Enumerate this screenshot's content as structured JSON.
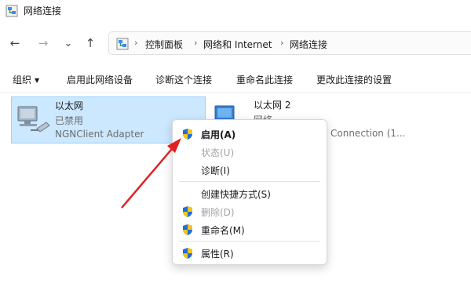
{
  "window": {
    "title": "网络连接"
  },
  "nav": {
    "back": "←",
    "forward": "→",
    "recent": "⌄",
    "up": "↑"
  },
  "address": {
    "sep": "›",
    "crumbs": [
      "控制面板",
      "网络和 Internet",
      "网络连接"
    ]
  },
  "commands": {
    "organize": "组织",
    "organize_caret": "▼",
    "enable_device": "启用此网络设备",
    "diagnose": "诊断这个连接",
    "rename": "重命名此连接",
    "change_settings": "更改此连接的设置"
  },
  "items": [
    {
      "name": "以太网",
      "status": "已禁用",
      "adapter": "NGNClient Adapter"
    },
    {
      "name": "以太网 2",
      "status": "网络",
      "adapter": "Connection (1..."
    }
  ],
  "context_menu": {
    "enable": "启用(A)",
    "status": "状态(U)",
    "diagnose": "诊断(I)",
    "create_shortcut": "创建快捷方式(S)",
    "delete": "删除(D)",
    "rename": "重命名(M)",
    "properties": "属性(R)"
  },
  "colors": {
    "selection_bg": "#cce8ff",
    "selection_border": "#99d1ff",
    "arrow": "#e02020",
    "shield_blue": "#1f6fd6",
    "shield_yellow": "#f5c518"
  },
  "icons": {
    "app": "network-connections-icon",
    "address": "network-connections-icon",
    "item": "ethernet-adapter-icon",
    "uac": "uac-shield-icon"
  }
}
